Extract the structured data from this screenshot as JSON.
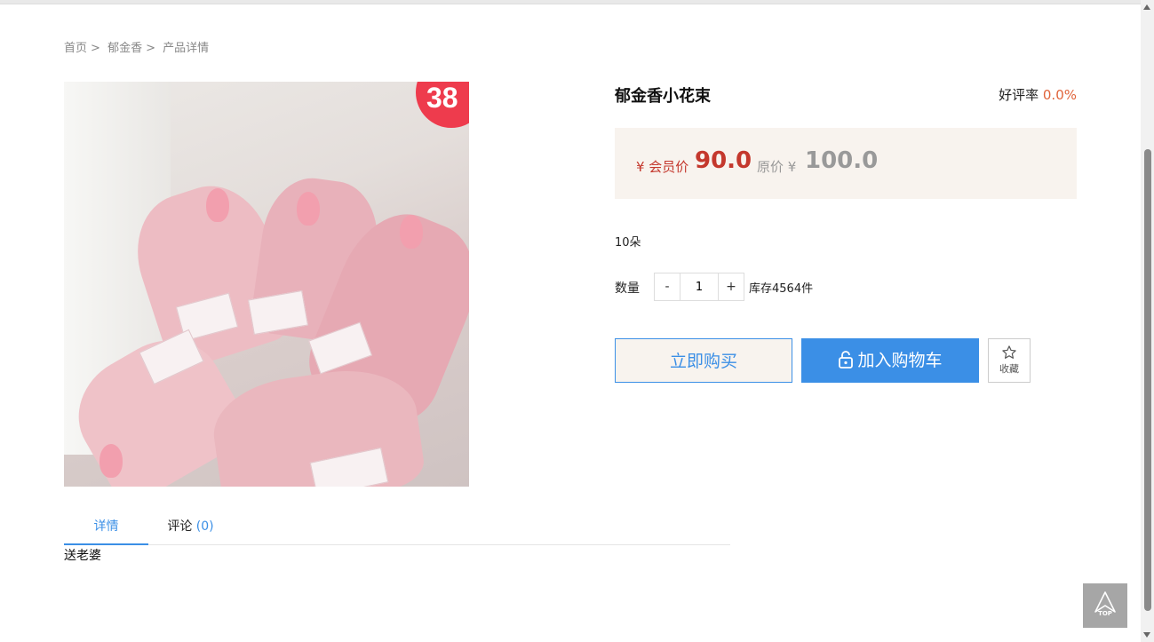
{
  "breadcrumb": {
    "home": "首页",
    "sep1": ">",
    "category": "郁金香",
    "sep2": ">",
    "current": "产品详情"
  },
  "image": {
    "alt_badge": "38"
  },
  "product": {
    "title": "郁金香小花束",
    "rating_label": "好评率",
    "rating_value": "0.0%",
    "member_label": "¥ 会员价",
    "member_price": "90.0",
    "orig_label": "原价 ¥",
    "orig_price": "100.0",
    "spec": "10朵",
    "qty_label": "数量",
    "qty_minus": "-",
    "qty_value": "1",
    "qty_plus": "+",
    "stock": "库存4564件"
  },
  "actions": {
    "buy": "立即购买",
    "cart": "加入购物车",
    "favorite": "收藏"
  },
  "tabs": {
    "detail": "详情",
    "comment": "评论",
    "comment_count": "(0)"
  },
  "detail_text": "送老婆",
  "back_to_top": "TOP",
  "colors": {
    "accent": "#3b8fe6",
    "price": "#c4382d",
    "rating": "#e0643a",
    "price_bg": "#f8f3ee"
  }
}
